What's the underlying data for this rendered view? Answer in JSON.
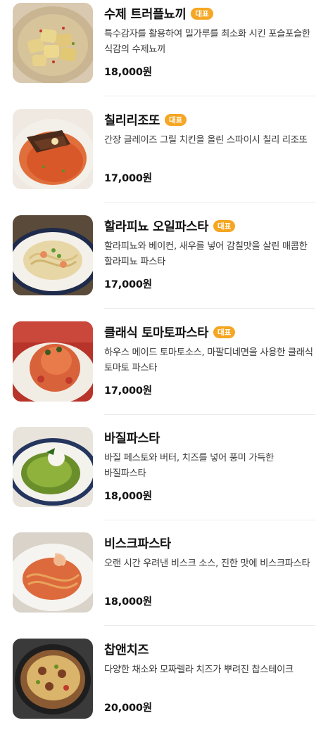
{
  "menu": {
    "items": [
      {
        "name": "수제 트러플뇨끼",
        "badge": "대표",
        "desc": "특수감자를 활용하여 밀가루를 최소화 시킨 포슬포슬한 식감의 수제뇨끼",
        "price": "18,000원",
        "image_icon": "gnocchi-photo"
      },
      {
        "name": "칠리리조또",
        "badge": "대표",
        "desc": "간장 글레이즈 그릴 치킨을 올린 스파이시 칠리 리조또",
        "price": "17,000원",
        "image_icon": "risotto-photo"
      },
      {
        "name": "할라피뇨 오일파스타",
        "badge": "대표",
        "desc": "할라피뇨와 베이컨, 새우를 넣어 감칠맛을 살린 매콤한 할라피뇨 파스타",
        "price": "17,000원",
        "image_icon": "oil-pasta-photo"
      },
      {
        "name": "클래식 토마토파스타",
        "badge": "대표",
        "desc": "하우스 메이드 토마토소스, 마팔디네면을 사용한 클래식 토마토 파스타",
        "price": "17,000원",
        "image_icon": "tomato-pasta-photo"
      },
      {
        "name": "바질파스타",
        "badge": "",
        "desc": "바질 페스토와 버터, 치즈를 넣어 풍미 가득한 바질파스타",
        "price": "18,000원",
        "image_icon": "basil-pasta-photo"
      },
      {
        "name": "비스크파스타",
        "badge": "",
        "desc": "오랜 시간 우려낸 비스크 소스, 진한 맛에 비스크파스타",
        "price": "18,000원",
        "image_icon": "bisque-pasta-photo"
      },
      {
        "name": "찹앤치즈",
        "badge": "",
        "desc": "다양한 채소와 모짜렐라 치즈가 뿌려진 찹스테이크",
        "price": "20,000원",
        "image_icon": "chop-cheese-photo"
      }
    ]
  },
  "colors": {
    "badge": "#f5a623",
    "divider": "#ececec"
  }
}
